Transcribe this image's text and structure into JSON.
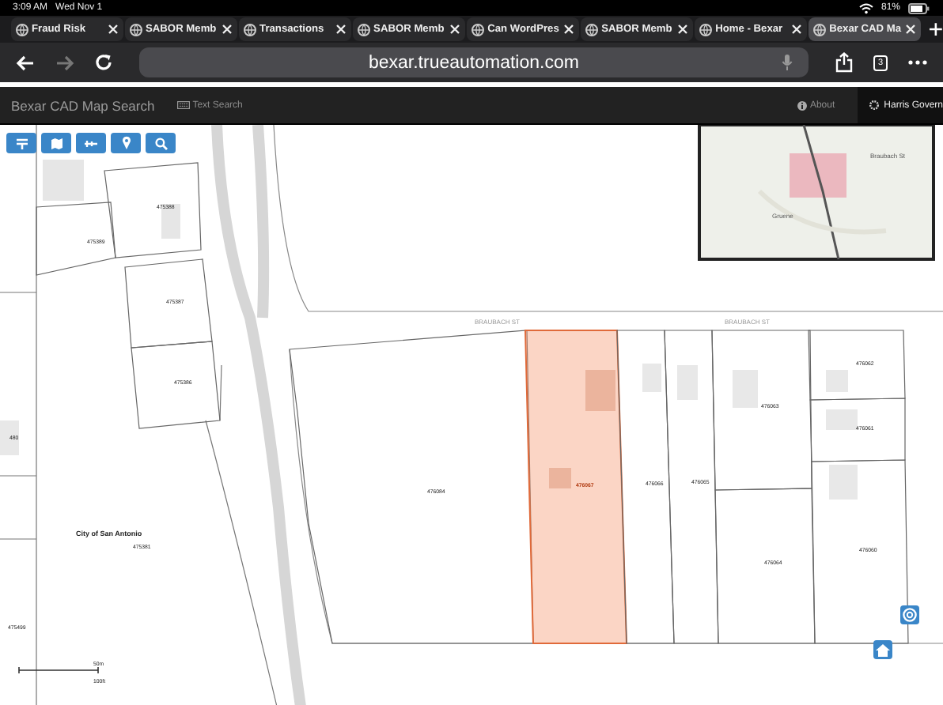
{
  "status_bar": {
    "time": "3:09 AM",
    "date": "Wed Nov 1",
    "battery": "81%"
  },
  "tabs": [
    {
      "title": "Fraud Risk",
      "selected": false
    },
    {
      "title": "SABOR Memb",
      "selected": false
    },
    {
      "title": "Transactions",
      "selected": false
    },
    {
      "title": "SABOR Memb",
      "selected": false
    },
    {
      "title": "Can WordPres",
      "selected": false
    },
    {
      "title": "SABOR Memb",
      "selected": false
    },
    {
      "title": "Home - Bexar",
      "selected": false
    },
    {
      "title": "Bexar CAD Ma",
      "selected": true
    }
  ],
  "address_bar": {
    "url": "bexar.trueautomation.com",
    "tab_count": "3"
  },
  "app_bar": {
    "title": "Bexar CAD Map Search",
    "links": [
      {
        "label": "Text Search"
      },
      {
        "label": "About"
      }
    ],
    "account": "Harris Govern"
  },
  "map": {
    "parcels": [
      {
        "label": "475388",
        "selected": false
      },
      {
        "label": "475389",
        "selected": false
      },
      {
        "label": "475387",
        "selected": false
      },
      {
        "label": "475386",
        "selected": false
      },
      {
        "label": "476084",
        "selected": false
      },
      {
        "label": "476067",
        "selected": true
      },
      {
        "label": "476066",
        "selected": false
      },
      {
        "label": "476065",
        "selected": false
      },
      {
        "label": "476063",
        "selected": false
      },
      {
        "label": "476064",
        "selected": false
      },
      {
        "label": "476062",
        "selected": false
      },
      {
        "label": "476061",
        "selected": false
      },
      {
        "label": "476060",
        "selected": false
      },
      {
        "label": "475381",
        "selected": false
      },
      {
        "label": "475499",
        "selected": false
      },
      {
        "label": "480",
        "selected": false
      }
    ],
    "streets": [
      "BRAUBACH ST",
      "BRAUBACH ST"
    ],
    "place_label": "City of San Antonio",
    "scale": {
      "metric": "50m",
      "imperial": "100ft"
    },
    "overview": {
      "labels": [
        "Braubach St",
        "Gruene"
      ]
    }
  }
}
